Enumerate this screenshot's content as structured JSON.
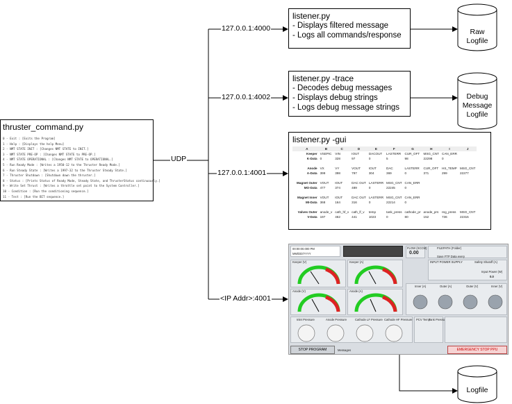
{
  "source": {
    "title": "thruster_command.py",
    "commands": [
      "0 - Exit : [Exits the Program]",
      "1 - Help : [Displays the help Menu]",
      "2 - NMT STATE INIT : [Changes NMT STATE to INIT.]",
      "3 - NMT STATE PRE-OP : [Changes NMT STATE to PRE-OP.]",
      "4 - NMT STATE OPERATIONAL : [Changes NMT STATE to OPERATIONAL.]",
      "5 - Run Ready Mode : [Writes a 1950-12 to the Thruster Ready Mode.]",
      "6 - Run Steady State : [Writes a 1997-32 to the Thruster Steady State.]",
      "7 - Thruster Shutdown : [Shutdown down the thruster.]",
      "8 - Status : [Prints Status of Ready Mode, Steady State, and ThrusterStatus continuously.]",
      "9 - Write Set Thrust : [Writes a throttle set point to the System Controller.]",
      "10 - Condition : [Run the conditioning sequence.]",
      "11 - Test : [Run the BIT sequence.]"
    ]
  },
  "connections": {
    "udp": "UDP",
    "port_4000": "127.0.0.1:4000",
    "port_4002": "127.0.0.1:4002",
    "port_4001": "127.0.0.1:4001",
    "ip_4001": "<IP Addr>:4001"
  },
  "listeners": {
    "plain": {
      "title": "listener.py",
      "lines": [
        "- Displays filtered message",
        "- Logs all commands/response"
      ]
    },
    "trace": {
      "title": "listener.py -trace",
      "lines": [
        "- Decodes debug messages",
        "- Displays debug strings",
        "- Logs debug message strings"
      ]
    },
    "gui": {
      "title": "listener.py -gui"
    }
  },
  "logfiles": {
    "raw": [
      "Raw",
      "Logfile"
    ],
    "debug": [
      "Debug",
      "Message",
      "Logfile"
    ],
    "log": [
      "Logfile"
    ]
  },
  "spreadsheet": {
    "columns": [
      "A",
      "B",
      "C",
      "D",
      "E",
      "F",
      "G",
      "H",
      "I",
      "J"
    ],
    "rows": [
      [
        "Keeper",
        "VSEPIC",
        "VIN",
        "IOUT",
        "DACOUT",
        "LASTERR",
        "CUR_OFT",
        "MSG_CNT",
        "CAN_ERR",
        ""
      ],
      [
        "K-Data",
        "0",
        "328",
        "97",
        "0",
        "5",
        "98",
        "22298",
        "0",
        ""
      ],
      [
        "",
        "",
        "",
        "",
        "",
        "",
        "",
        "",
        "",
        ""
      ],
      [
        "Anode",
        "VX",
        "VY",
        "VOUT",
        "IOUT",
        "DAC",
        "LASTERR",
        "CUR_OFT",
        "HS_TEMP",
        "MSG_CNT"
      ],
      [
        "A-Data",
        "399",
        "398",
        "797",
        "304",
        "369",
        "0",
        "371",
        "299",
        "22277"
      ],
      [
        "",
        "",
        "",
        "",
        "",
        "",
        "",
        "",
        "",
        ""
      ],
      [
        "Magnet Outer",
        "VOUT",
        "IOUT",
        "DAC OUT",
        "LASTERR",
        "MSG_CNT",
        "CAN_ERR",
        "",
        "",
        ""
      ],
      [
        "MO-Data",
        "477",
        "374",
        "489",
        "0",
        "22245",
        "0",
        "",
        "",
        ""
      ],
      [
        "",
        "",
        "",
        "",
        "",
        "",
        "",
        "",
        "",
        ""
      ],
      [
        "Magnet Inner",
        "VOUT",
        "IOUT",
        "DAC OUT",
        "LASTERR",
        "MSG_CNT",
        "CAN_ERR",
        "",
        "",
        ""
      ],
      [
        "MI-Data",
        "368",
        "164",
        "316",
        "0",
        "22214",
        "0",
        "",
        "",
        ""
      ],
      [
        "",
        "",
        "",
        "",
        "",
        "",
        "",
        "",
        "",
        ""
      ],
      [
        "Valves Outer",
        "anode_v",
        "cath_hf_v",
        "cath_lf_v",
        "temp",
        "tank_press",
        "cathode_pr",
        "anode_prs",
        "reg_press",
        "MSG_CNT"
      ],
      [
        "V-Data",
        "197",
        "462",
        "441",
        "1023",
        "0",
        "80",
        "152",
        "736",
        "22315"
      ]
    ]
  },
  "gui_panel": {
    "datetime": "00:00:00.000 PM",
    "date_fmt": "MM/DD/YYYY",
    "flow_label": "FLOW (SCCM)",
    "flow_value": "0.00",
    "filepath_label": "FILEPATH (Folder)",
    "save_label": "Save FTP Data every",
    "input_power_label": "INPUT POWER SUPPLY",
    "safety_label": "Safety Shutoff (A)",
    "input_power_value_label": "Input Power (W)",
    "input_power_value": "0.0",
    "keeper_a": "Keeper (A)",
    "keeper_v": "Keeper (V)",
    "anode_v": "Anode (V)",
    "anode_a": "Anode (A)",
    "inner_a": "Inner (A)",
    "outer_a": "Outer (A)",
    "outer_v": "Outer (V)",
    "inner_v": "Inner (V)",
    "pressures": [
      "Inlet Pressure",
      "Anode Pressure",
      "Cathode LF Pressure",
      "Cathode HF Pressure"
    ],
    "pcv_temp": "PCV Temp",
    "tank_pressure": "Tank Pressure",
    "stop_program": "STOP PROGRAM",
    "estop": "EMERGENCY STOP PPU",
    "messages": "Messages"
  },
  "colors": {
    "line": "#000000",
    "estop": "#cc0000"
  }
}
